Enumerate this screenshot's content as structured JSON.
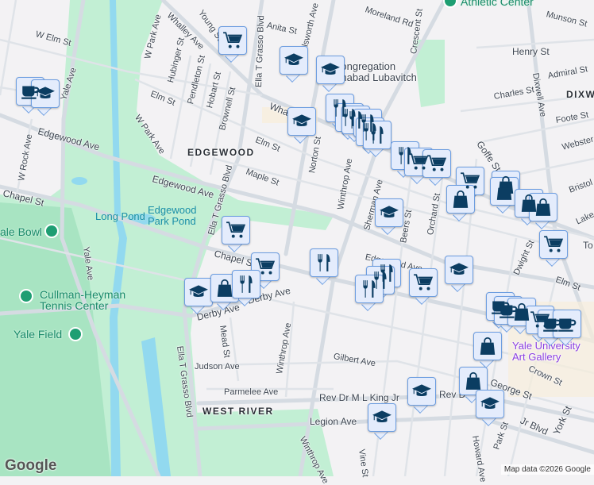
{
  "map": {
    "colors": {
      "background": "#f3f2f4",
      "park": "#c2efd4",
      "park_dark": "#a8e4c2",
      "water": "#92d9ef",
      "road": "#d5dbe2",
      "marker_bg": "#e4ecfc",
      "marker_border": "#6c9de0",
      "icon": "#0b3d62"
    },
    "districts": [
      "EDGEWOOD",
      "WEST RIVER",
      "DIXW"
    ],
    "streets": [
      "W Elm St",
      "Yale Ave",
      "W Park Ave",
      "Whalley Ave",
      "Young St",
      "Ella T Grasso Blvd",
      "Anita St",
      "Ellsworth Ave",
      "Moreland Rd",
      "Crescent St",
      "Henry St",
      "Munson St",
      "Hubinger St",
      "Pendleton St",
      "Hobart St",
      "Brownell St",
      "Elm St",
      "Maple St",
      "Norton St",
      "Winthrop Ave",
      "Sherman Ave",
      "Edgewood Ave",
      "W Rock Ave",
      "Chapel St",
      "Derby Ave",
      "Mead St",
      "Judson Ave",
      "Parmelee Ave",
      "Gilbert Ave",
      "Rev Dr M L King Jr",
      "Rev D",
      "Jr Blvd",
      "Legion Ave",
      "Vine St",
      "Howard Ave",
      "Park St",
      "Crown St",
      "York St",
      "Goffe St",
      "Dixwell Ave",
      "Admiral St",
      "Charles St",
      "Foote St",
      "Webster",
      "Bristol",
      "Lake",
      "Orchard St",
      "Beers St",
      "Dwight St",
      "To",
      "George St",
      "Whalley"
    ],
    "places": {
      "long_pond": "Long Pond",
      "edgewood_pond": "Edgewood Park Pond",
      "yale_bowl": "ale Bowl",
      "tennis": "Cullman-Heyman Tennis Center",
      "yale_field": "Yale Field",
      "chabad": "Congregation Chabad Lubavitch",
      "athletic": "Athletic Center",
      "gallery": "Yale University Art Gallery"
    },
    "pois": [
      "cart",
      "coffee",
      "school",
      "school",
      "school",
      "restaurant",
      "restaurant",
      "restaurant",
      "restaurant",
      "restaurant",
      "restaurant",
      "school",
      "restaurant",
      "cart",
      "cart",
      "cart",
      "bag",
      "bag",
      "bag",
      "bag",
      "bag",
      "school",
      "cart",
      "cart",
      "restaurant",
      "restaurant",
      "restaurant",
      "restaurant",
      "cart",
      "school",
      "school",
      "bag",
      "restaurant",
      "coffee",
      "coffee",
      "bag",
      "cart",
      "coffee",
      "coffee",
      "bag",
      "bag",
      "school",
      "school",
      "school",
      "cart"
    ],
    "logo": "Google",
    "attribution": "Map data ©2026 Google"
  }
}
